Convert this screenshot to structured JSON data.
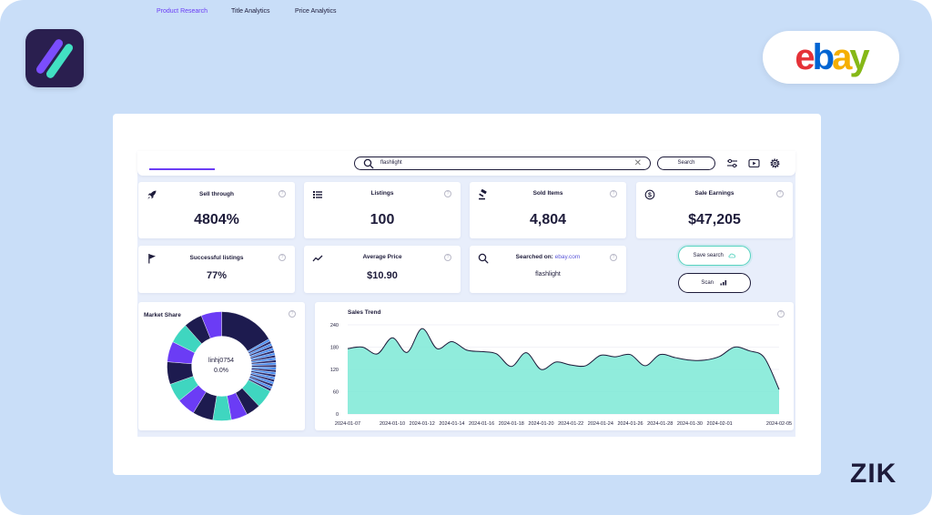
{
  "brand": {
    "zik_wordmark": "ZIK",
    "ebay_letters": [
      "e",
      "b",
      "a",
      "y"
    ],
    "ebay_colors": [
      "#e53238",
      "#0064d2",
      "#f5af02",
      "#86b817"
    ],
    "accent": "#6b3cf5",
    "teal": "#7de9d6"
  },
  "tabs": [
    {
      "label": "Product Research",
      "active": true
    },
    {
      "label": "Title Analytics",
      "active": false
    },
    {
      "label": "Price Analytics",
      "active": false
    }
  ],
  "search": {
    "value": "flashlight",
    "button_label": "Search",
    "icon": "search-icon",
    "clear_icon": "close-icon"
  },
  "toolbar_icons": [
    "sliders-icon",
    "video-icon",
    "gear-icon"
  ],
  "stats": {
    "sell_through": {
      "label": "Sell through",
      "value": "4804%",
      "icon": "rocket-icon"
    },
    "listings": {
      "label": "Listings",
      "value": "100",
      "icon": "list-icon"
    },
    "sold_items": {
      "label": "Sold Items",
      "value": "4,804",
      "icon": "gavel-icon"
    },
    "sale_earnings": {
      "label": "Sale Earnings",
      "value": "$47,205",
      "icon": "dollar-icon"
    },
    "successful_listings": {
      "label": "Successful listings",
      "value": "77%",
      "icon": "flag-icon"
    },
    "average_price": {
      "label": "Average Price",
      "value": "$10.90",
      "icon": "trend-icon"
    },
    "searched_on": {
      "label_prefix": "Searched on: ",
      "label_link": "ebay.com",
      "value": "flashlight",
      "icon": "search-icon"
    }
  },
  "actions": {
    "save_search": "Save search",
    "scan": "Scan"
  },
  "market_share": {
    "title": "Market Share",
    "center_name": "linhj0754",
    "center_value": "0.0%"
  },
  "chart_data": {
    "type": "area",
    "title": "Sales Trend",
    "xlabel": "",
    "ylabel": "",
    "ylim": [
      0,
      240
    ],
    "yticks": [
      0,
      60,
      120,
      180,
      240
    ],
    "grid": true,
    "color": "#7de9d6",
    "xtick_labels": [
      "2024-01-07",
      "2024-01-10",
      "2024-01-12",
      "2024-01-14",
      "2024-01-16",
      "2024-01-18",
      "2024-01-20",
      "2024-01-22",
      "2024-01-24",
      "2024-01-26",
      "2024-01-28",
      "2024-01-30",
      "2024-02-01",
      "2024-02-05"
    ],
    "x": [
      "2024-01-07",
      "2024-01-08",
      "2024-01-09",
      "2024-01-10",
      "2024-01-11",
      "2024-01-12",
      "2024-01-13",
      "2024-01-14",
      "2024-01-15",
      "2024-01-16",
      "2024-01-17",
      "2024-01-18",
      "2024-01-19",
      "2024-01-20",
      "2024-01-21",
      "2024-01-22",
      "2024-01-23",
      "2024-01-24",
      "2024-01-25",
      "2024-01-26",
      "2024-01-27",
      "2024-01-28",
      "2024-01-29",
      "2024-01-30",
      "2024-01-31",
      "2024-02-01",
      "2024-02-02",
      "2024-02-03",
      "2024-02-04",
      "2024-02-05"
    ],
    "series": [
      {
        "values": [
          176,
          180,
          162,
          205,
          166,
          230,
          176,
          195,
          172,
          168,
          162,
          128,
          165,
          120,
          140,
          132,
          130,
          158,
          154,
          160,
          130,
          160,
          152,
          145,
          145,
          155,
          180,
          170,
          152,
          66
        ]
      }
    ]
  }
}
